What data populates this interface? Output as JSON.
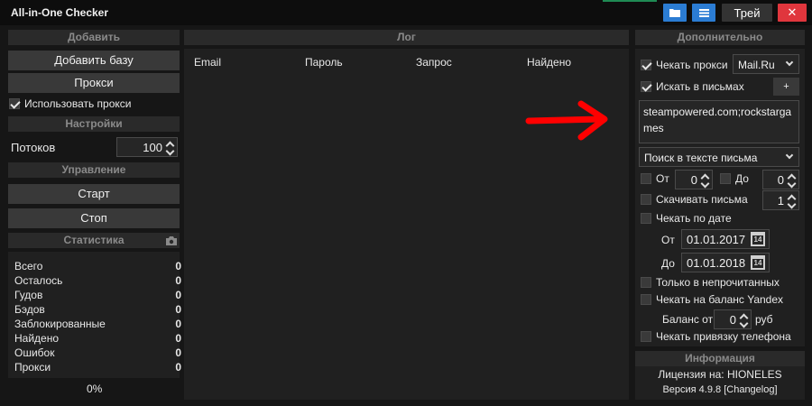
{
  "window": {
    "title": "All-in-One Checker",
    "tray_label": "Трей",
    "close_label": "✕"
  },
  "left": {
    "add_header": "Добавить",
    "add_base_label": "Добавить базу",
    "proxy_label": "Прокси",
    "use_proxy": {
      "label": "Использовать прокси",
      "checked": true
    },
    "settings_header": "Настройки",
    "threads_label": "Потоков",
    "threads_value": "100",
    "control_header": "Управление",
    "start_label": "Старт",
    "stop_label": "Стоп",
    "stats_header": "Статистика",
    "stats": [
      {
        "label": "Всего",
        "value": "0"
      },
      {
        "label": "Осталось",
        "value": "0"
      },
      {
        "label": "Гудов",
        "value": "0"
      },
      {
        "label": "Бэдов",
        "value": "0"
      },
      {
        "label": "Заблокированные",
        "value": "0"
      },
      {
        "label": "Найдено",
        "value": "0"
      },
      {
        "label": "Ошибок",
        "value": "0"
      },
      {
        "label": "Прокси",
        "value": "0"
      }
    ],
    "progress": "0%"
  },
  "log": {
    "header": "Лог",
    "columns": [
      "Email",
      "Пароль",
      "Запрос",
      "Найдено"
    ]
  },
  "extra": {
    "header": "Дополнительно",
    "check_proxy": {
      "label": "Чекать прокси",
      "checked": true
    },
    "proxy_provider": "Mail.Ru",
    "search_in_mail": {
      "label": "Искать в письмах",
      "checked": true
    },
    "add_label": "+",
    "query_text": "steampowered.com;rockstargames",
    "search_mode": "Поиск в тексте письма",
    "from_label": "От",
    "from_value": "0",
    "to_label": "До",
    "to_value": "0",
    "download_mail": {
      "label": "Скачивать письма",
      "checked": false,
      "value": "1"
    },
    "check_by_date": {
      "label": "Чекать по дате",
      "checked": false
    },
    "date_from_label": "От",
    "date_from": "01.01.2017",
    "date_to_label": "До",
    "date_to": "01.01.2018",
    "calendar_day": "14",
    "only_unread": {
      "label": "Только в непрочитанных",
      "checked": false
    },
    "check_yandex_balance": {
      "label": "Чекать на баланс Yandex",
      "checked": false
    },
    "balance_label": "Баланс от",
    "balance_value": "0",
    "balance_unit": "руб",
    "check_phone": {
      "label": "Чекать привязку телефона",
      "checked": false
    }
  },
  "info": {
    "header": "Информация",
    "license": "Лицензия на: HIONELES",
    "version": "Версия 4.9.8 [Changelog]"
  },
  "colors": {
    "accent_blue": "#2b7cd3",
    "close_red": "#e0363d",
    "arrow_red": "#ff0000"
  }
}
